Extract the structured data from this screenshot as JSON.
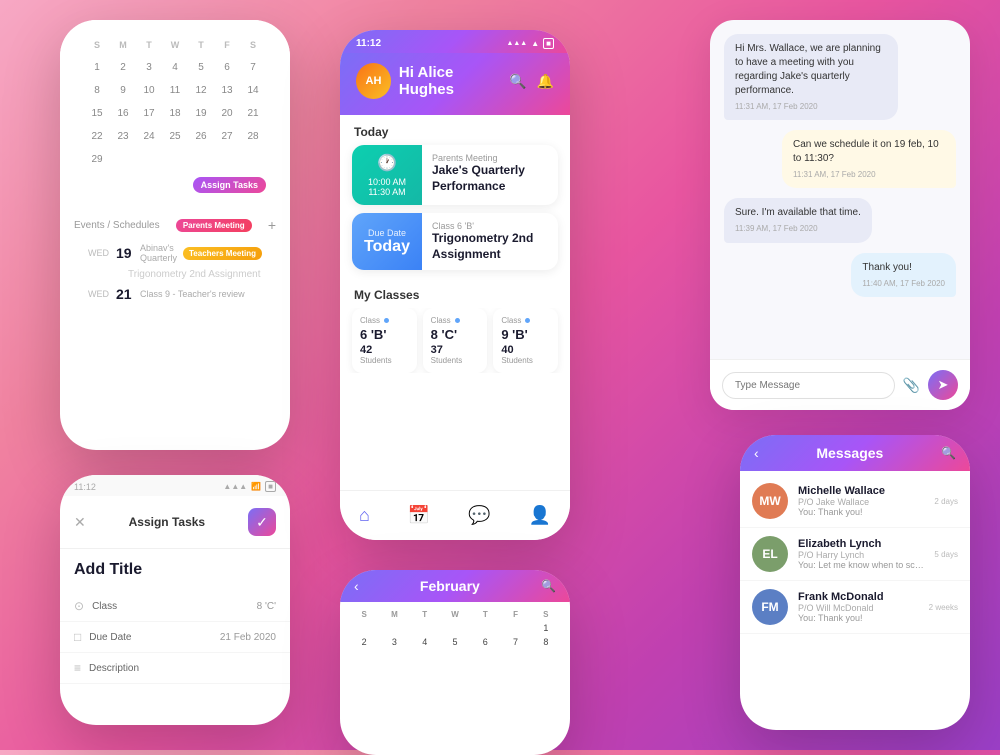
{
  "colors": {
    "gradient_start": "#7b6ef6",
    "gradient_end": "#ec4899",
    "accent_green": "#0dcfb0",
    "accent_blue": "#3b82f6",
    "accent_yellow": "#fbbf24"
  },
  "status_bar": {
    "time": "11:12",
    "wifi": "wifi",
    "signal": "signal",
    "battery": "battery"
  },
  "main_phone": {
    "greeting": "Hi Alice Hughes",
    "today_label": "Today",
    "event1": {
      "time_start": "10:00 AM",
      "time_end": "11:30 AM",
      "sub": "Parents Meeting",
      "title": "Jake's Quarterly Performance"
    },
    "event2": {
      "due_label": "Due Date",
      "due_value": "Today",
      "sub": "Class 6 'B'",
      "title": "Trigonometry 2nd Assignment"
    },
    "classes_label": "My Classes",
    "classes": [
      {
        "label": "Class",
        "name": "6 'B'",
        "count": "42",
        "students": "Students"
      },
      {
        "label": "Class",
        "name": "8 'C'",
        "count": "37",
        "students": "Students"
      },
      {
        "label": "Class",
        "name": "9 'B'",
        "count": "40",
        "students": "Students"
      }
    ]
  },
  "calendar_phone": {
    "month": "February",
    "days_header": [
      "S",
      "M",
      "T",
      "W",
      "T",
      "F",
      "S"
    ],
    "weeks": [
      [
        "",
        "",
        "",
        "",
        "",
        "",
        "1"
      ],
      [
        "2",
        "3",
        "4",
        "5",
        "6",
        "7",
        "8"
      ]
    ]
  },
  "left_calendar": {
    "month_rows": [
      [
        "S",
        "M",
        "T",
        "W",
        "T",
        "F",
        "S"
      ],
      [
        "1",
        "2",
        "3",
        "4",
        "5",
        "6",
        "7"
      ],
      [
        "8",
        "9",
        "10",
        "11",
        "12",
        "13",
        "14"
      ],
      [
        "15",
        "16",
        "17",
        "18",
        "19",
        "20",
        "21"
      ],
      [
        "22",
        "23",
        "24",
        "25",
        "26",
        "27",
        "28"
      ],
      [
        "29",
        "",
        "",
        "",
        "",
        "",
        ""
      ]
    ],
    "assign_tasks": "Assign Tasks",
    "events_label": "Events / Schedules",
    "parents_meeting": "Parents Meeting",
    "schedule": [
      {
        "day": "WED",
        "date": "19",
        "name": "Abinav's Quarterly",
        "badge": "Teachers Meeting"
      },
      {
        "day": "",
        "date": "",
        "title": "Trigonometry 2nd Assignment",
        "badge": ""
      },
      {
        "day": "WED",
        "date": "21",
        "name": "Class 9 - Teacher's review",
        "badge": ""
      }
    ]
  },
  "task_phone": {
    "header": "Assign Tasks",
    "add_title": "Add Title",
    "class_label": "Class",
    "class_value": "8 'C'",
    "due_label": "Due Date",
    "due_value": "21 Feb 2020",
    "description_label": "Description"
  },
  "chat": {
    "messages": [
      {
        "type": "received",
        "text": "Hi Mrs. Wallace, we are planning to have a meeting with you regarding Jake's quarterly performance.",
        "time": "11:31 AM, 17 Feb 2020"
      },
      {
        "type": "sent",
        "text": "Can we schedule it on 19 feb, 10 to 11:30?",
        "time": "11:31 AM, 17 Feb 2020"
      },
      {
        "type": "received",
        "text": "Sure. I'm available that time.",
        "time": "11:39 AM, 17 Feb 2020"
      },
      {
        "type": "sent-blue",
        "text": "Thank you!",
        "time": "11:40 AM, 17 Feb 2020"
      }
    ],
    "input_placeholder": "Type Message",
    "send_label": "send"
  },
  "messages_phone": {
    "title": "Messages",
    "contacts": [
      {
        "name": "Michelle Wallace",
        "sub": "P/O Jake Wallace",
        "preview": "You: Thank you!",
        "time": "2 days",
        "color": "#e07b54"
      },
      {
        "name": "Elizabeth Lynch",
        "sub": "P/O Harry Lynch",
        "preview": "You: Let me know when to schedule.",
        "time": "5 days",
        "color": "#7b9e6b"
      },
      {
        "name": "Frank McDonald",
        "sub": "P/O Will McDonald",
        "preview": "You: Thank you!",
        "time": "2 weeks",
        "color": "#5b7fc4"
      }
    ]
  }
}
